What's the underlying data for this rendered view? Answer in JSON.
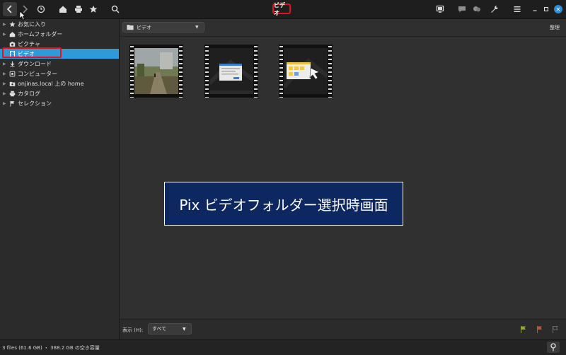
{
  "header": {
    "title": "ビデオ",
    "icons": [
      "back-icon",
      "forward-icon",
      "history-icon",
      "home-icon",
      "printer-icon",
      "star-icon",
      "search-icon",
      "monitor-icon",
      "comment-icon",
      "tag-icon",
      "wrench-icon",
      "menu-icon",
      "minimize-icon",
      "maximize-icon",
      "close-icon"
    ],
    "close_glyph": "✕"
  },
  "sidebar": {
    "items": [
      {
        "label": "お気に入り",
        "icon": "star-icon"
      },
      {
        "label": "ホームフォルダー",
        "icon": "home-icon"
      },
      {
        "label": "ピクチャ",
        "icon": "camera-icon"
      },
      {
        "label": "ビデオ",
        "icon": "film-icon",
        "selected": true
      },
      {
        "label": "ダウンロード",
        "icon": "download-icon"
      },
      {
        "label": "コンピューター",
        "icon": "computer-icon"
      },
      {
        "label": "onjinas.local 上の home",
        "icon": "network-folder-icon"
      },
      {
        "label": "カタログ",
        "icon": "catalog-icon"
      },
      {
        "label": "セレクション",
        "icon": "flag-icon"
      }
    ],
    "expand_glyph": "▶"
  },
  "toolbar": {
    "folder_select": "ビデオ",
    "organize": "整理"
  },
  "banner": "Pix ビデオフォルダー選択時画面",
  "bottombar": {
    "view_label": "表示 (H):",
    "view_select": "すべて"
  },
  "status": {
    "text": "3 files (61.6 GB) ・ 388.2 GB の空き容量"
  },
  "colors": {
    "accent": "#2e9ad8",
    "highlight_outline": "#e0141c",
    "banner_bg": "#0d2760",
    "flag_green": "#9aa33a",
    "flag_red": "#c0553a",
    "flag_gray": "#6a6a6a"
  }
}
